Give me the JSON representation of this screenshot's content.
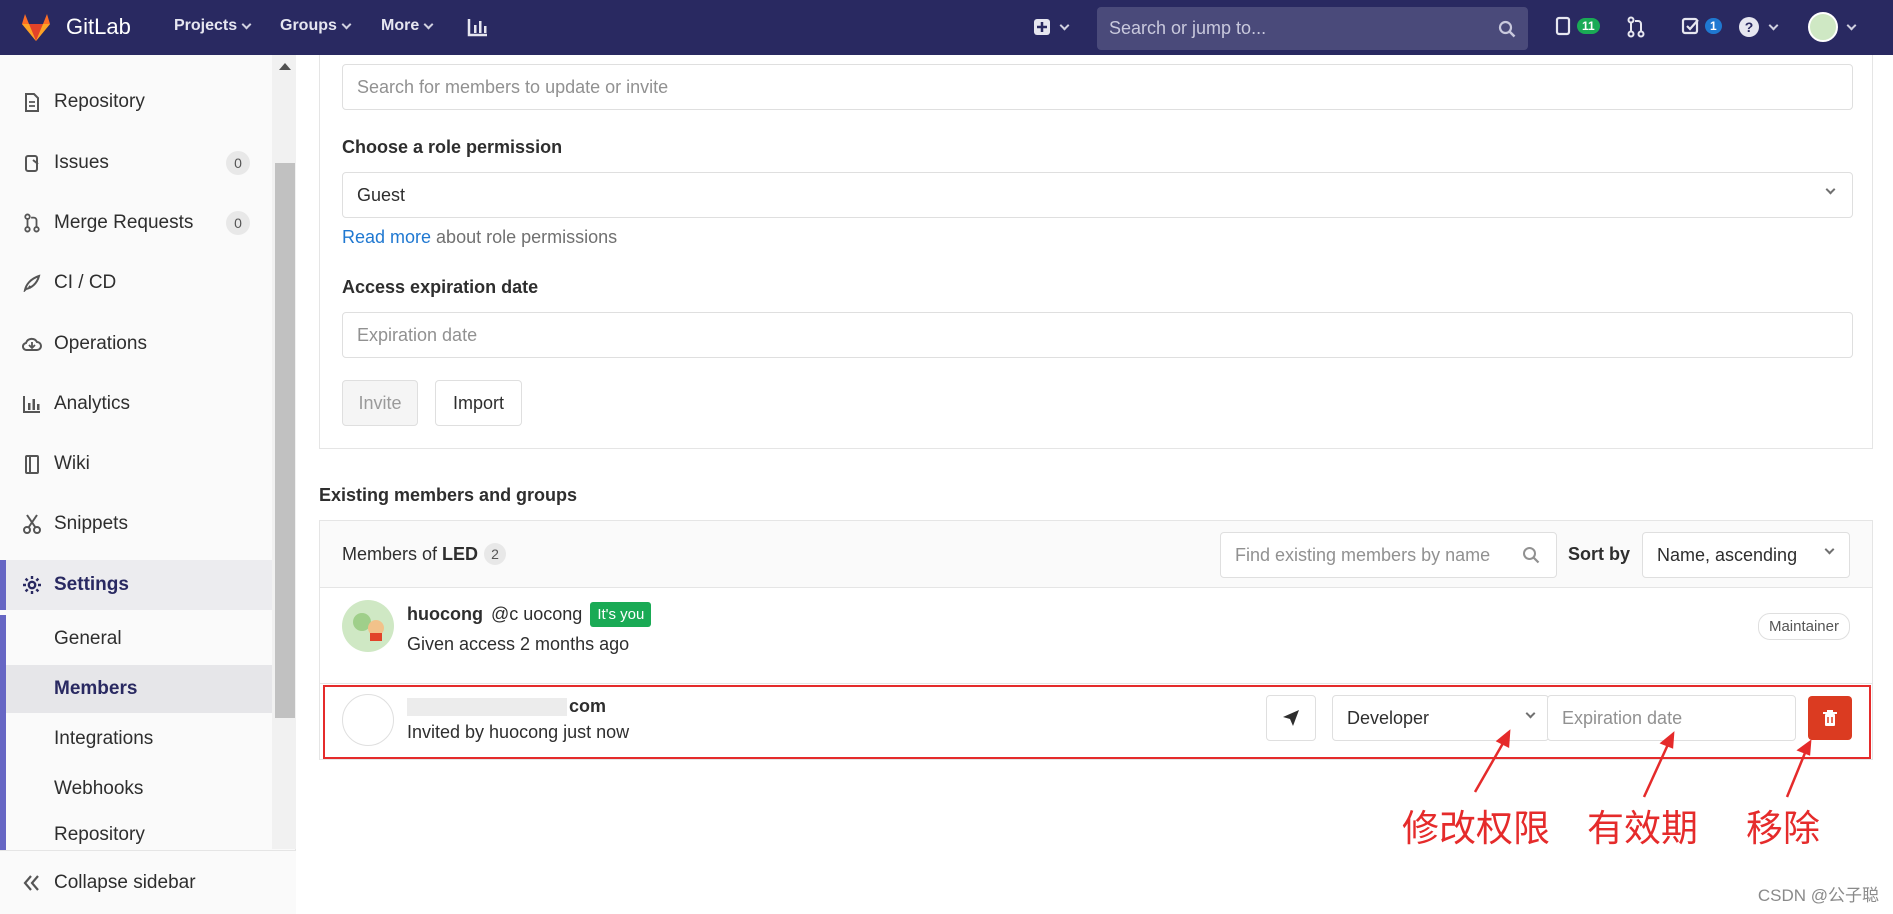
{
  "navbar": {
    "logo_text": "GitLab",
    "projects": "Projects",
    "groups": "Groups",
    "more": "More",
    "search_placeholder": "Search or jump to...",
    "issues_count": "11",
    "todos_count": "1",
    "colors": {
      "bg": "#292961"
    }
  },
  "sidebar": {
    "items": [
      {
        "label": "Repository",
        "icon": "doc-icon"
      },
      {
        "label": "Issues",
        "icon": "issues-icon",
        "count": "0"
      },
      {
        "label": "Merge Requests",
        "icon": "merge-request-icon",
        "count": "0"
      },
      {
        "label": "CI / CD",
        "icon": "rocket-icon"
      },
      {
        "label": "Operations",
        "icon": "cloud-icon"
      },
      {
        "label": "Analytics",
        "icon": "chart-icon"
      },
      {
        "label": "Wiki",
        "icon": "book-icon"
      },
      {
        "label": "Snippets",
        "icon": "scissors-icon"
      },
      {
        "label": "Settings",
        "icon": "gear-icon"
      }
    ],
    "settings_sub": [
      "General",
      "Members",
      "Integrations",
      "Webhooks",
      "Repository"
    ],
    "collapse": "Collapse sidebar"
  },
  "invite": {
    "member_search_placeholder": "Search for members to update or invite",
    "role_label": "Choose a role permission",
    "role_value": "Guest",
    "read_more": "Read more",
    "read_more_suffix": " about role permissions",
    "expiration_label": "Access expiration date",
    "expiration_placeholder": "Expiration date",
    "invite_btn": "Invite",
    "import_btn": "Import"
  },
  "existing": {
    "title": "Existing members and groups",
    "members_of_prefix": "Members of ",
    "group_name": "LED",
    "member_count": "2",
    "find_placeholder": "Find existing members by name",
    "sort_label": "Sort by",
    "sort_value": "Name, ascending",
    "members": [
      {
        "name": "huocong",
        "handle": "@c        uocong",
        "tag": "It's you",
        "meta": "Given access 2 months ago",
        "role": "Maintainer"
      },
      {
        "name": "com",
        "meta": "Invited by huocong just now",
        "role": "Developer",
        "expiration_placeholder": "Expiration date"
      }
    ]
  },
  "annotations": {
    "edit": "修改权限",
    "expire": "有效期",
    "remove": "移除",
    "color": "#e52b2b"
  },
  "watermark": "CSDN @公子聪"
}
